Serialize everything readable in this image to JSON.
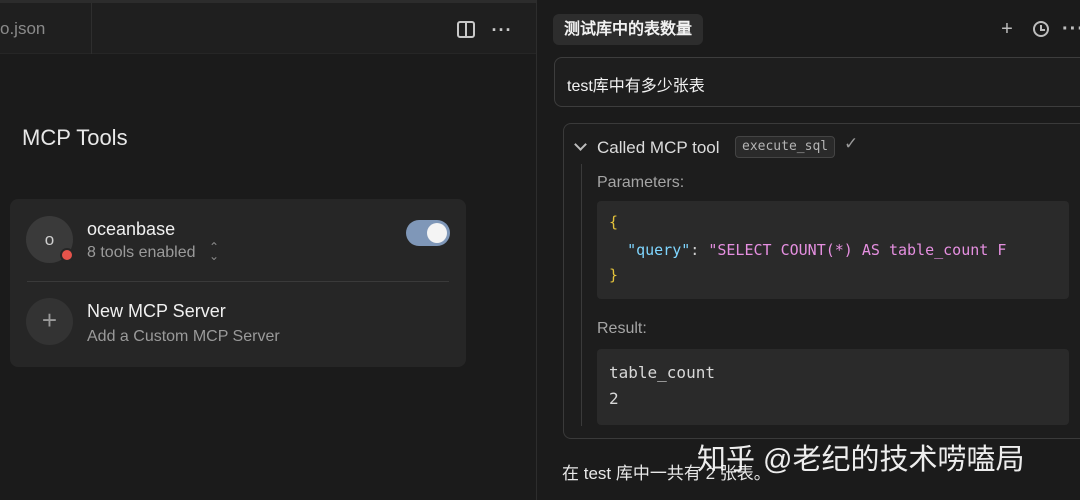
{
  "editor": {
    "tab_label": "o.json",
    "split_icon": "split-view-icon",
    "more_icon": "more-horizontal-icon"
  },
  "mcp": {
    "title": "MCP Tools",
    "server": {
      "avatar_letter": "o",
      "name": "oceanbase",
      "status": "8 tools enabled",
      "status_dot_color": "#e5534b",
      "toggle_on": true,
      "toggle_color": "#7f97b8"
    },
    "new_server": {
      "icon": "+",
      "name": "New MCP Server",
      "subtitle": "Add a Custom MCP Server"
    }
  },
  "chat": {
    "title": "测试库中的表数量",
    "plus_icon": "+",
    "user_message": "test库中有多少张表",
    "tool_call": {
      "label": "Called MCP tool",
      "tool_name": "execute_sql",
      "check": "✓",
      "params_label": "Parameters:",
      "code": {
        "open_brace": "{",
        "key": "\"query\"",
        "colon": ": ",
        "value": "\"SELECT COUNT(*) AS table_count F",
        "close_brace": "}"
      },
      "result_label": "Result:",
      "result_header": "table_count",
      "result_value": "2"
    },
    "answer": "在 test 库中一共有 2 张表。"
  },
  "watermark": "知乎 @老纪的技术唠嗑局"
}
